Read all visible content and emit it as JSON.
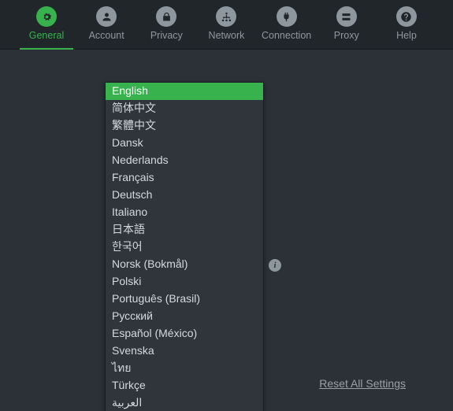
{
  "tabs": [
    {
      "label": "General",
      "icon": "gear"
    },
    {
      "label": "Account",
      "icon": "user"
    },
    {
      "label": "Privacy",
      "icon": "lock"
    },
    {
      "label": "Network",
      "icon": "network"
    },
    {
      "label": "Connection",
      "icon": "plug"
    },
    {
      "label": "Proxy",
      "icon": "server"
    },
    {
      "label": "Help",
      "icon": "question"
    }
  ],
  "active_tab": "General",
  "language_dropdown": {
    "selected": "English",
    "options": [
      "English",
      "简体中文",
      "繁體中文",
      "Dansk",
      "Nederlands",
      "Français",
      "Deutsch",
      "Italiano",
      "日本語",
      "한국어",
      "Norsk (Bokmål)",
      "Polski",
      "Português (Brasil)",
      "Русский",
      "Español (México)",
      "Svenska",
      "ไทย",
      "Türkçe",
      "العربية"
    ]
  },
  "reset_label": "Reset All Settings",
  "colors": {
    "accent": "#37b24d",
    "bg": "#2b3137",
    "tabbar": "#21262b"
  }
}
